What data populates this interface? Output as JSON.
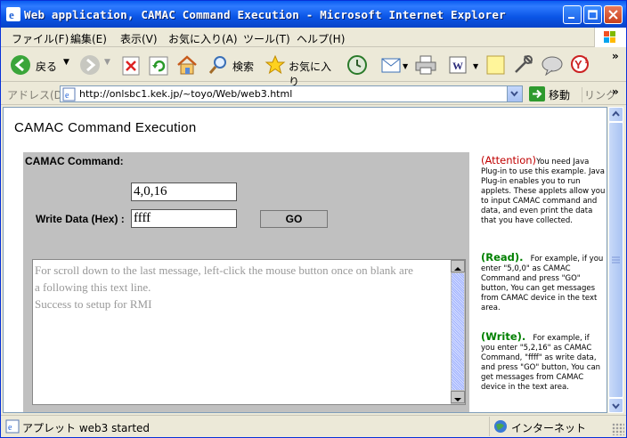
{
  "window": {
    "title": "Web application, CAMAC Command Execution - Microsoft Internet Explorer"
  },
  "menu": {
    "items": [
      "ファイル(F)",
      "編集(E)",
      "表示(V)",
      "お気に入り(A)",
      "ツール(T)",
      "ヘルプ(H)"
    ]
  },
  "toolbar": {
    "back_label": "戻る",
    "search_label": "検索",
    "favorites_label": "お気に入り"
  },
  "address": {
    "label": "アドレス(D)",
    "url": "http://onlsbc1.kek.jp/~toyo/Web/web3.html",
    "go_label": "移動",
    "links_label": "リンク"
  },
  "page": {
    "heading": "CAMAC Command Execution",
    "applet": {
      "command_label": "CAMAC Command:",
      "command_value": "4,0,16",
      "write_label": "Write Data (Hex) :",
      "write_value": "ffff",
      "go_button": "GO",
      "output_lines": [
        "For scroll down to the last message, left-click the mouse button once on blank are",
        "a following this text line.",
        "Success to setup for RMI"
      ]
    },
    "notes": {
      "attention_header": "(Attention)",
      "attention_body": "You need Java Plug-in to use this example. Java Plug-in enables you to run applets. These applets allow you to input CAMAC command and data, and even print the data that you have collected.",
      "read_header": "(Read).",
      "read_body": "For example, if you enter \"5,0,0\" as CAMAC Command and press \"GO\" button, You can get messages from CAMAC device in the text area.",
      "write_header": "(Write).",
      "write_body": "For example, if you enter \"5,2,16\" as CAMAC Command, \"ffff\" as write data, and press \"GO\" button, You can get messages from CAMAC device in the text area."
    }
  },
  "status": {
    "text": "アプレット web3 started",
    "zone": "インターネット"
  },
  "colors": {
    "titlebar": "#0a55e6",
    "applet_bg": "#c0c0c0",
    "attention": "#c00000",
    "headers_green": "#008000"
  }
}
